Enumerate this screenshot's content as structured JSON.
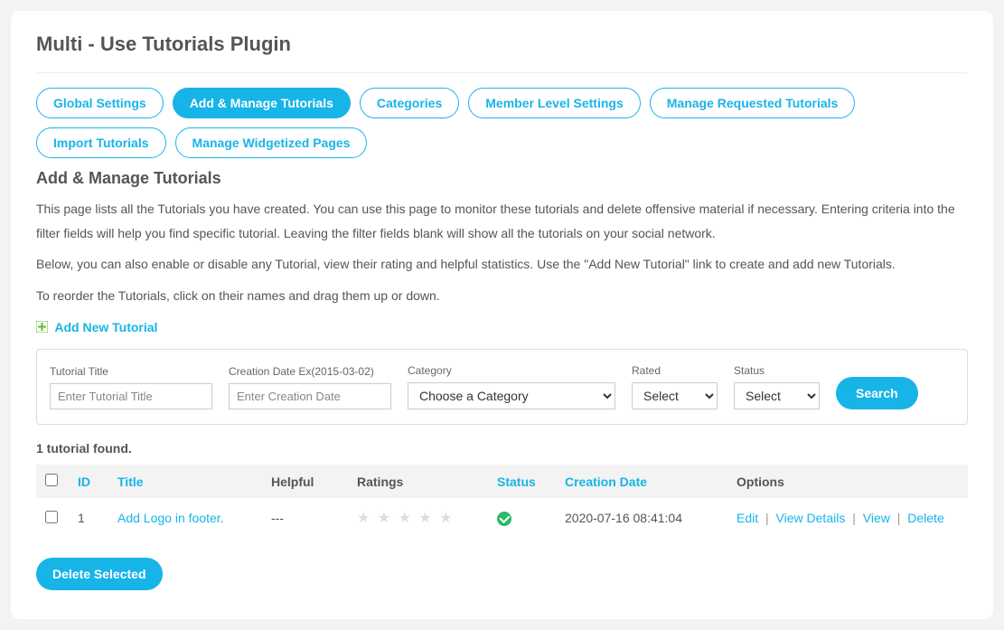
{
  "page_title": "Multi - Use Tutorials Plugin",
  "tabs": [
    {
      "label": "Global Settings",
      "active": false
    },
    {
      "label": "Add & Manage Tutorials",
      "active": true
    },
    {
      "label": "Categories",
      "active": false
    },
    {
      "label": "Member Level Settings",
      "active": false
    },
    {
      "label": "Manage Requested Tutorials",
      "active": false
    },
    {
      "label": "Import Tutorials",
      "active": false
    },
    {
      "label": "Manage Widgetized Pages",
      "active": false
    }
  ],
  "section_title": "Add & Manage Tutorials",
  "desc1": "This page lists all the Tutorials you have created. You can use this page to monitor these tutorials and delete offensive material if necessary. Entering criteria into the filter fields will help you find specific tutorial. Leaving the filter fields blank will show all the tutorials on your social network.",
  "desc2": "Below, you can also enable or disable any Tutorial, view their rating and helpful statistics. Use the \"Add New Tutorial\" link to create and add new Tutorials.",
  "desc3": "To reorder the Tutorials, click on their names and drag them up or down.",
  "add_new_label": "Add New Tutorial",
  "filters": {
    "title_label": "Tutorial Title",
    "title_placeholder": "Enter Tutorial Title",
    "date_label": "Creation Date Ex(2015-03-02)",
    "date_placeholder": "Enter Creation Date",
    "category_label": "Category",
    "category_selected": "Choose a Category",
    "rated_label": "Rated",
    "rated_selected": "Select",
    "status_label": "Status",
    "status_selected": "Select",
    "search_btn": "Search"
  },
  "found_text": "1 tutorial found.",
  "columns": {
    "id": "ID",
    "title": "Title",
    "helpful": "Helpful",
    "ratings": "Ratings",
    "status": "Status",
    "creation_date": "Creation Date",
    "options": "Options"
  },
  "rows": [
    {
      "id": "1",
      "title": "Add Logo in footer.",
      "helpful": "---",
      "ratings_value": 0,
      "status_ok": true,
      "creation_date": "2020-07-16 08:41:04"
    }
  ],
  "row_actions": {
    "edit": "Edit",
    "view_details": "View Details",
    "view": "View",
    "delete": "Delete"
  },
  "delete_selected": "Delete Selected"
}
